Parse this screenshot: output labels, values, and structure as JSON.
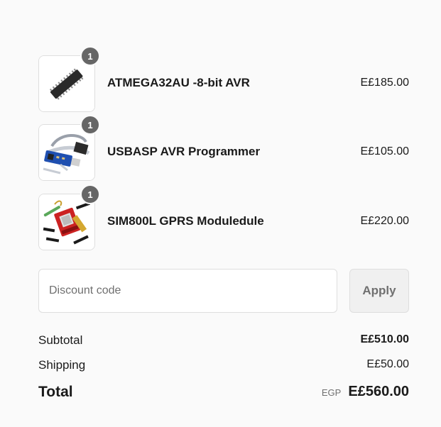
{
  "line_items": [
    {
      "name": "ATMEGA32AU -8-bit AVR",
      "price": "E£185.00",
      "quantity": "1",
      "image_icon": "chip-icon"
    },
    {
      "name": "USBASP AVR Programmer",
      "price": "E£105.00",
      "quantity": "1",
      "image_icon": "usb-programmer-icon"
    },
    {
      "name": "SIM800L GPRS Moduledule",
      "price": "E£220.00",
      "quantity": "1",
      "image_icon": "gsm-module-icon"
    }
  ],
  "discount": {
    "placeholder": "Discount code",
    "value": "",
    "apply_label": "Apply"
  },
  "summary": {
    "subtotal_label": "Subtotal",
    "subtotal_value": "E£510.00",
    "shipping_label": "Shipping",
    "shipping_value": "E£50.00",
    "total_label": "Total",
    "currency_code": "EGP",
    "total_value": "E£560.00"
  },
  "colors": {
    "background": "#fafafa",
    "badge": "#666666",
    "border": "#dedede",
    "muted_text": "#707070"
  }
}
